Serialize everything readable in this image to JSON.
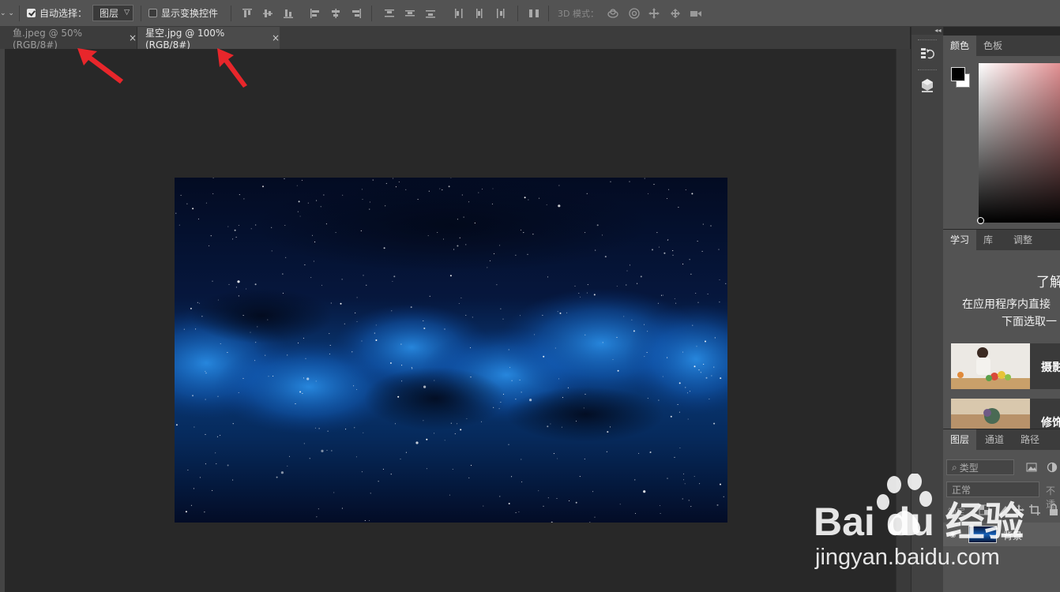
{
  "options_bar": {
    "auto_select_label": "自动选择：",
    "auto_select_target": "图层",
    "show_transform_label": "显示变换控件",
    "mode_3d_label": "3D 模式："
  },
  "tabs": [
    {
      "label": "鱼.jpeg @ 50%(RGB/8#)",
      "active": false
    },
    {
      "label": "星空.jpg @ 100%(RGB/8#)",
      "active": true
    }
  ],
  "tab_close_glyph": "×",
  "color_panel": {
    "tabs": [
      "颜色",
      "色板"
    ],
    "active_tab": "颜色",
    "foreground": "#000000",
    "background": "#ffffff",
    "hue_color": "#e0898c"
  },
  "learn_panel": {
    "tabs": [
      "学习",
      "库",
      "调整"
    ],
    "active_tab": "学习",
    "heading": "了解",
    "line1": "在应用程序内直接",
    "line2": "下面选取一",
    "cards": [
      {
        "label": "摄影"
      },
      {
        "label": "修饰"
      }
    ]
  },
  "layers_panel": {
    "tabs": [
      "图层",
      "通道",
      "路径"
    ],
    "active_tab": "图层",
    "filter_placeholder": "类型",
    "blend_mode": "正常",
    "opacity_label": "不透",
    "lock_label": "锁定",
    "layers": [
      {
        "name": "背景"
      }
    ]
  },
  "watermark": {
    "brand": "Bai du 经验",
    "url": "jingyan.baidu.com"
  },
  "colors": {
    "annotation_arrow": "#e8262b",
    "app_bg": "#282828",
    "panel_bg": "#535353"
  }
}
